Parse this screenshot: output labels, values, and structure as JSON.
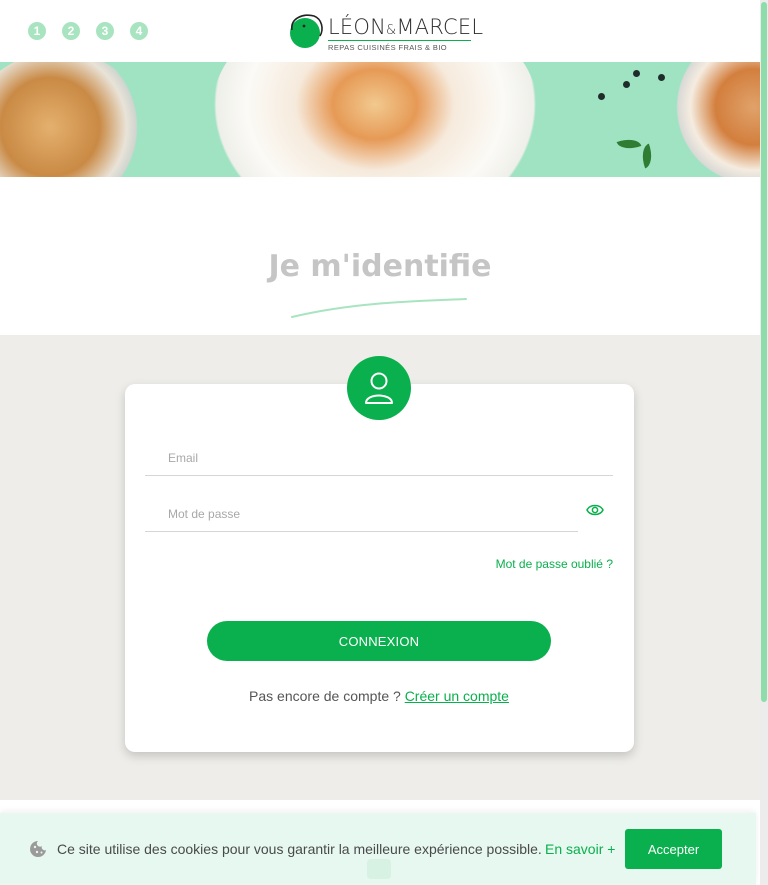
{
  "header": {
    "steps": [
      "1",
      "2",
      "3",
      "4"
    ],
    "logo": {
      "name_part1": "LÉON",
      "name_amp": "&",
      "name_part2": "MARCEL",
      "tagline": "REPAS CUISINÉS FRAIS & BIO"
    }
  },
  "page": {
    "title": "Je m'identifie"
  },
  "form": {
    "email_placeholder": "Email",
    "password_placeholder": "Mot de passe",
    "forgot_password": "Mot de passe oublié ?",
    "connect_button": "CONNEXION",
    "no_account_text": "Pas encore de compte ?",
    "create_account_link": "Créer un compte"
  },
  "cookie_bar": {
    "message": "Ce site utilise des cookies pour vous garantir la meilleure expérience possible.",
    "learn_more": "En savoir +",
    "accept_button": "Accepter"
  },
  "colors": {
    "brand_green": "#0ab04d",
    "light_green": "#a9e4c0",
    "banner_mint": "#9fe3c2",
    "form_background": "#eeede9",
    "cookie_background": "#e6f8ef"
  },
  "icons": [
    "user-icon",
    "eye-icon",
    "cookie-icon",
    "logo-mark-icon"
  ]
}
